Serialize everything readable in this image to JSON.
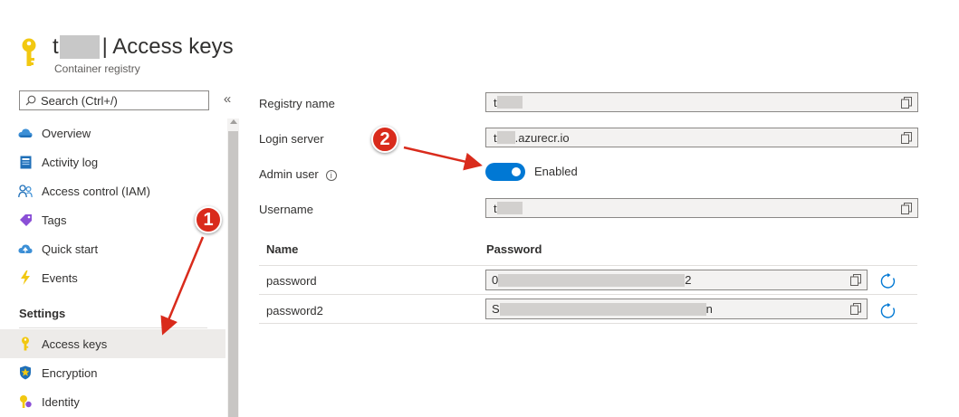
{
  "header": {
    "title_prefix": "t",
    "title_suffix": "| Access keys",
    "subtitle": "Container registry"
  },
  "sidebar": {
    "search_placeholder": "Search (Ctrl+/)",
    "collapse_glyph": "«",
    "items": [
      {
        "label": "Overview",
        "icon": "overview-cloud-icon"
      },
      {
        "label": "Activity log",
        "icon": "activity-log-icon"
      },
      {
        "label": "Access control (IAM)",
        "icon": "people-icon"
      },
      {
        "label": "Tags",
        "icon": "tag-icon"
      },
      {
        "label": "Quick start",
        "icon": "quick-start-cloud-icon"
      },
      {
        "label": "Events",
        "icon": "lightning-icon"
      }
    ],
    "settings_label": "Settings",
    "settings_items": [
      {
        "label": "Access keys",
        "icon": "key-icon",
        "active": true
      },
      {
        "label": "Encryption",
        "icon": "shield-icon"
      },
      {
        "label": "Identity",
        "icon": "identity-key-icon"
      }
    ]
  },
  "main": {
    "registry_name_label": "Registry name",
    "registry_name_value": "t",
    "login_server_label": "Login server",
    "login_server_prefix": "t",
    "login_server_suffix": ".azurecr.io",
    "admin_user_label": "Admin user",
    "admin_user_info": "i",
    "admin_user_state": "Enabled",
    "username_label": "Username",
    "username_value": "t",
    "table": {
      "headers": [
        "Name",
        "Password"
      ],
      "rows": [
        {
          "name": "password",
          "value_start": "0",
          "value_end": "2"
        },
        {
          "name": "password2",
          "value_start": "S",
          "value_end": "n"
        }
      ]
    }
  },
  "annotations": {
    "badge_1": "1",
    "badge_2": "2",
    "color": "#d92b1c"
  },
  "colors": {
    "accent": "#0078d4",
    "key_gold": "#f2c811"
  }
}
